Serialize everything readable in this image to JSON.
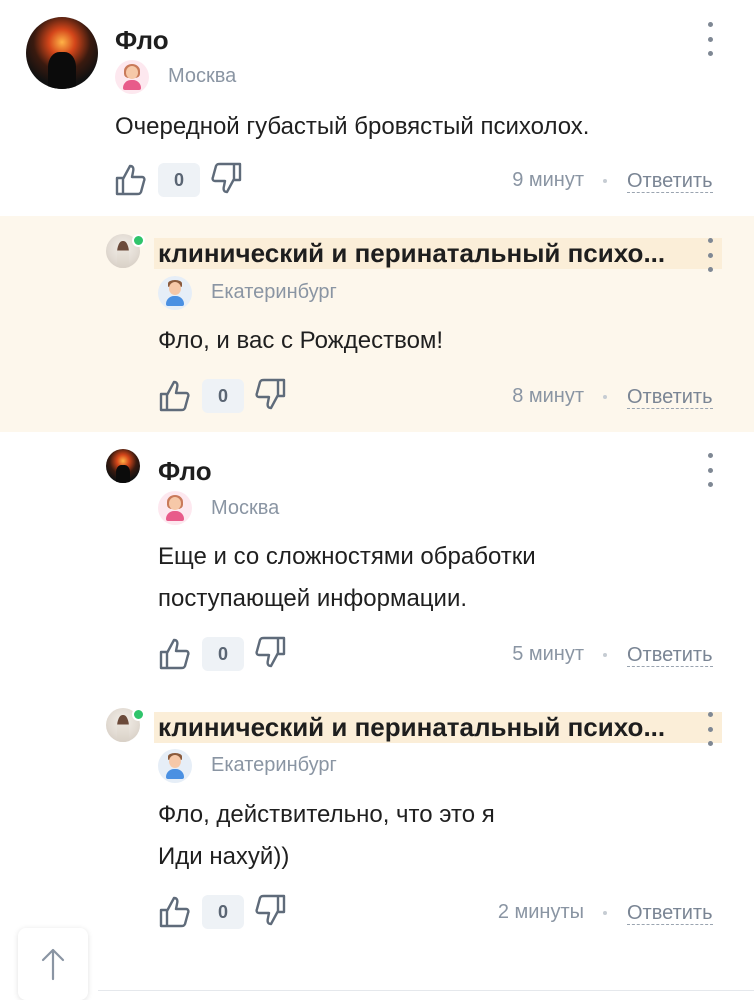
{
  "comments": [
    {
      "author": "Фло",
      "city": "Москва",
      "text_lines": [
        "Очередной губастый бровястый психолох."
      ],
      "likes": "0",
      "time": "9 минут",
      "reply_label": "Ответить"
    },
    {
      "author": "клинический и перинатальный психо...",
      "city": "Екатеринбург",
      "mention": "Фло",
      "text_rest": ", и вас с Рождеством!",
      "likes": "0",
      "time": "8 минут",
      "reply_label": "Ответить"
    },
    {
      "author": "Фло",
      "city": "Москва",
      "text_lines": [
        "Еще и со сложностями обработки",
        "поступающей информации."
      ],
      "likes": "0",
      "time": "5 минут",
      "reply_label": "Ответить"
    },
    {
      "author": "клинический и перинатальный психо...",
      "city": "Екатеринбург",
      "mention": "Фло",
      "text_rest": ", действительно, что это я",
      "text_line2": "Иди нахуй))",
      "likes": "0",
      "time": "2 минуты",
      "reply_label": "Ответить"
    }
  ],
  "colors": {
    "highlight_bg": "#fdf7ec",
    "meta_text": "#8a95a3",
    "online": "#2fc46b"
  },
  "icons": {
    "like": "thumb-up-icon",
    "dislike": "thumb-down-icon",
    "menu": "kebab-menu-icon",
    "scroll_top": "arrow-up-icon"
  }
}
